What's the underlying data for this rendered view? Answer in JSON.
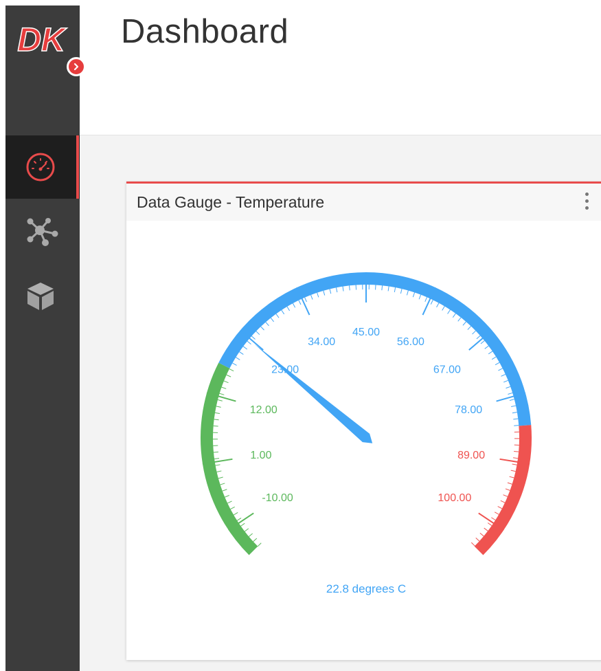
{
  "app": {
    "logo_text": "DK",
    "page_title": "Dashboard"
  },
  "sidebar": {
    "items": [
      {
        "icon": "speedometer-icon",
        "active": true
      },
      {
        "icon": "network-icon",
        "active": false
      },
      {
        "icon": "cube-icon",
        "active": false
      }
    ],
    "expand_icon": "chevron-right-icon"
  },
  "widget": {
    "title": "Data Gauge - Temperature",
    "menu_icon": "kebab-menu-icon"
  },
  "gauge": {
    "min": -15,
    "max": 105,
    "value": 22.8,
    "unit_label": "22.8 degrees C",
    "major_ticks": [
      "-10.00",
      "1.00",
      "12.00",
      "23.00",
      "34.00",
      "45.00",
      "56.00",
      "67.00",
      "78.00",
      "89.00",
      "100.00"
    ],
    "tick_values": [
      -10,
      1,
      12,
      23,
      34,
      45,
      56,
      67,
      78,
      89,
      100
    ],
    "bands": [
      {
        "from": -15,
        "to": 17,
        "color": "#5cb85c"
      },
      {
        "from": 17,
        "to": 83,
        "color": "#42a5f5"
      },
      {
        "from": 83,
        "to": 105,
        "color": "#ef5350"
      }
    ],
    "colors": {
      "low": "#5cb85c",
      "mid": "#42a5f5",
      "high": "#ef5350",
      "needle": "#42a5f5"
    }
  },
  "colors": {
    "accent": "#e84b4b",
    "sidebar_bg": "#3c3c3c",
    "sidebar_active_bg": "#1e1e1e"
  }
}
